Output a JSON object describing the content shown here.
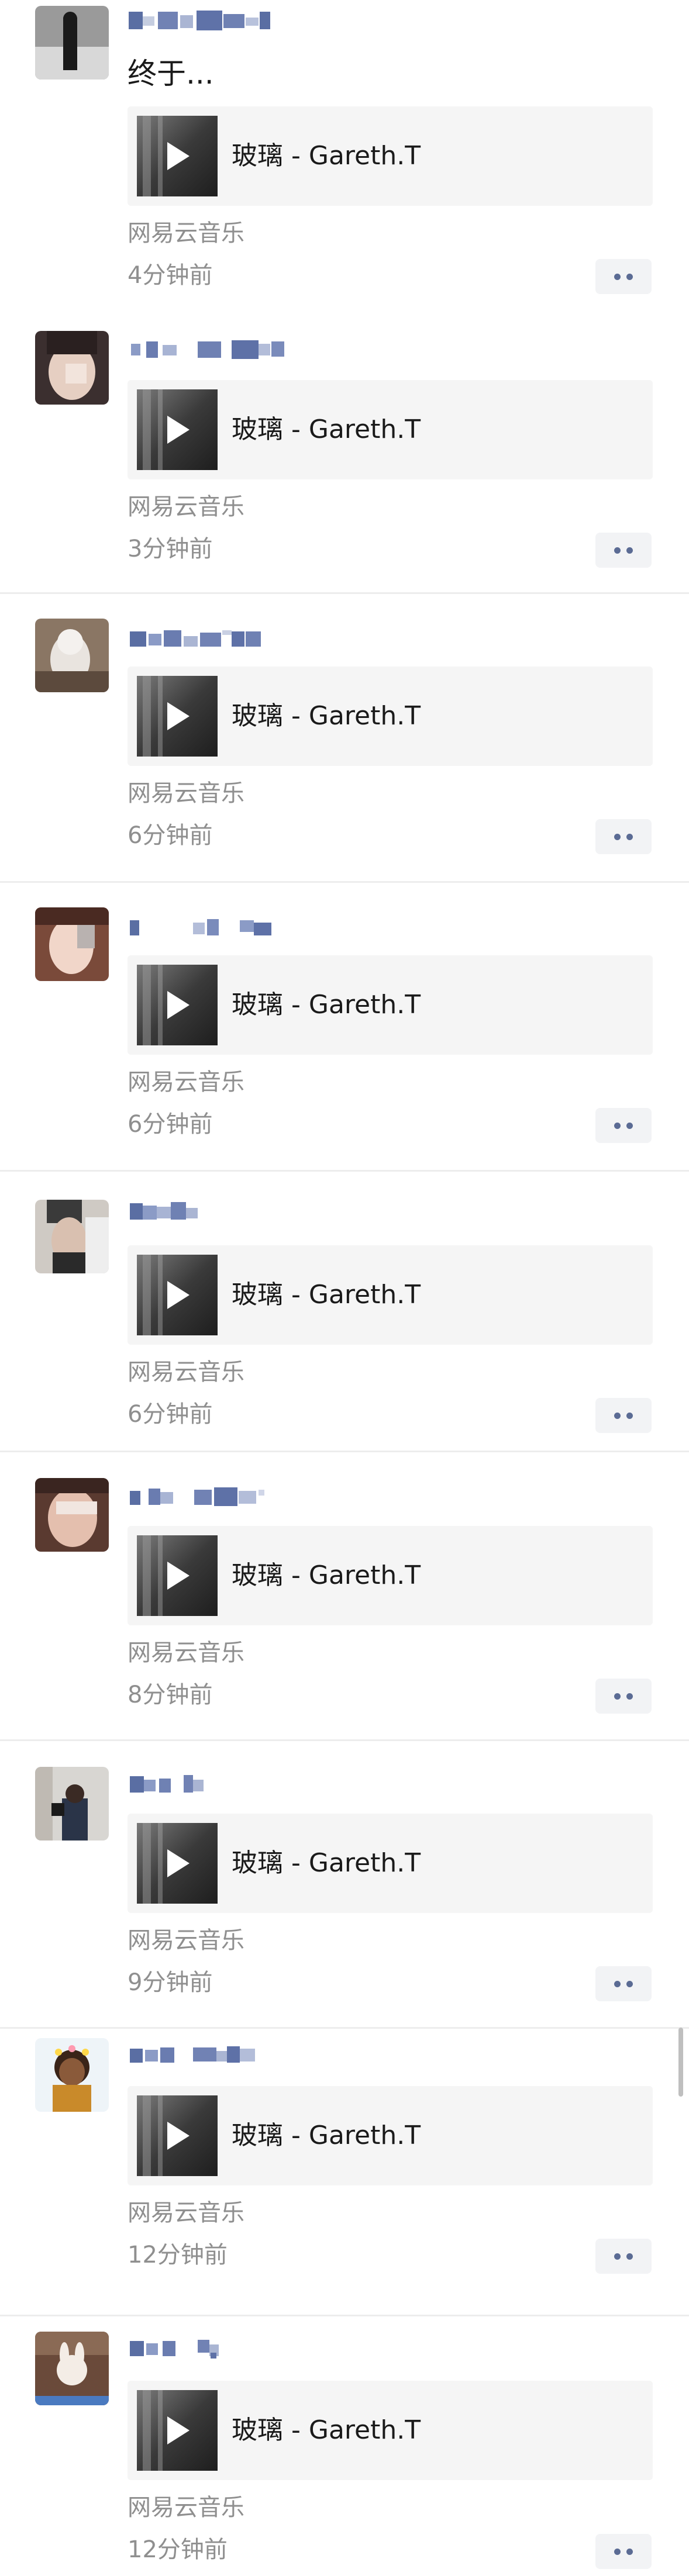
{
  "feed": {
    "posts": [
      {
        "text": "终于...",
        "song": "玻璃 - Gareth.T",
        "source": "网易云音乐",
        "time": "4分钟前"
      },
      {
        "text": "",
        "song": "玻璃 - Gareth.T",
        "source": "网易云音乐",
        "time": "3分钟前"
      },
      {
        "text": "",
        "song": "玻璃 - Gareth.T",
        "source": "网易云音乐",
        "time": "6分钟前"
      },
      {
        "text": "",
        "song": "玻璃 - Gareth.T",
        "source": "网易云音乐",
        "time": "6分钟前"
      },
      {
        "text": "",
        "song": "玻璃 - Gareth.T",
        "source": "网易云音乐",
        "time": "6分钟前"
      },
      {
        "text": "",
        "song": "玻璃 - Gareth.T",
        "source": "网易云音乐",
        "time": "8分钟前"
      },
      {
        "text": "",
        "song": "玻璃 - Gareth.T",
        "source": "网易云音乐",
        "time": "9分钟前"
      },
      {
        "text": "",
        "song": "玻璃 - Gareth.T",
        "source": "网易云音乐",
        "time": "12分钟前"
      },
      {
        "text": "",
        "song": "玻璃 - Gareth.T",
        "source": "网易云音乐",
        "time": "12分钟前"
      }
    ]
  },
  "icons": {
    "play": "play-icon",
    "more": "more-options-icon"
  },
  "colors": {
    "background": "#ffffff",
    "card": "#f5f5f5",
    "secondary_text": "#8f8f8f",
    "name_blur": "#6b7aa8",
    "more_dots": "#5b6b94",
    "divider": "#ededed"
  }
}
